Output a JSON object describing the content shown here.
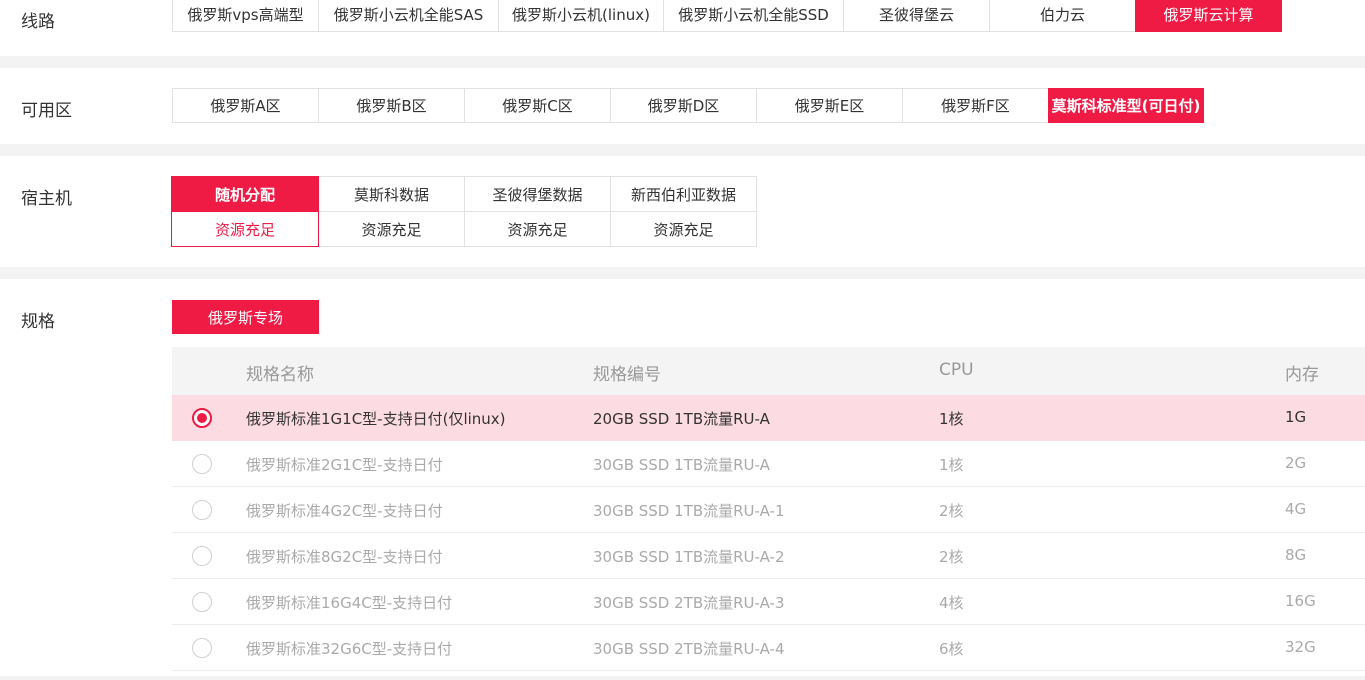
{
  "line": {
    "label": "线路",
    "options": [
      "俄罗斯vps高端型",
      "俄罗斯小云机全能SAS",
      "俄罗斯小云机(linux)",
      "俄罗斯小云机全能SSD",
      "圣彼得堡云",
      "伯力云",
      "俄罗斯云计算"
    ],
    "active_index": 6
  },
  "zone": {
    "label": "可用区",
    "options": [
      "俄罗斯A区",
      "俄罗斯B区",
      "俄罗斯C区",
      "俄罗斯D区",
      "俄罗斯E区",
      "俄罗斯F区",
      "莫斯科标准型(可日付)"
    ],
    "active_index": 6
  },
  "host": {
    "label": "宿主机",
    "options": [
      {
        "name": "随机分配",
        "status": "资源充足"
      },
      {
        "name": "莫斯科数据",
        "status": "资源充足"
      },
      {
        "name": "圣彼得堡数据",
        "status": "资源充足"
      },
      {
        "name": "新西伯利亚数据",
        "status": "资源充足"
      }
    ],
    "active_index": 0
  },
  "spec": {
    "label": "规格",
    "group_button": "俄罗斯专场",
    "columns": [
      "规格名称",
      "规格编号",
      "CPU",
      "内存"
    ],
    "rows": [
      {
        "name": "俄罗斯标准1G1C型-支持日付(仅linux)",
        "code": "20GB SSD 1TB流量RU-A",
        "cpu": "1核",
        "mem": "1G",
        "selected": true
      },
      {
        "name": "俄罗斯标准2G1C型-支持日付",
        "code": "30GB SSD 1TB流量RU-A",
        "cpu": "1核",
        "mem": "2G",
        "selected": false
      },
      {
        "name": "俄罗斯标准4G2C型-支持日付",
        "code": "30GB SSD 1TB流量RU-A-1",
        "cpu": "2核",
        "mem": "4G",
        "selected": false
      },
      {
        "name": "俄罗斯标准8G2C型-支持日付",
        "code": "30GB SSD 1TB流量RU-A-2",
        "cpu": "2核",
        "mem": "8G",
        "selected": false
      },
      {
        "name": "俄罗斯标准16G4C型-支持日付",
        "code": "30GB SSD 2TB流量RU-A-3",
        "cpu": "4核",
        "mem": "16G",
        "selected": false
      },
      {
        "name": "俄罗斯标准32G6C型-支持日付",
        "code": "30GB SSD 2TB流量RU-A-4",
        "cpu": "6核",
        "mem": "32G",
        "selected": false
      }
    ]
  },
  "colors": {
    "accent": "#f01b45",
    "selected_row": "#fcdbe2"
  }
}
